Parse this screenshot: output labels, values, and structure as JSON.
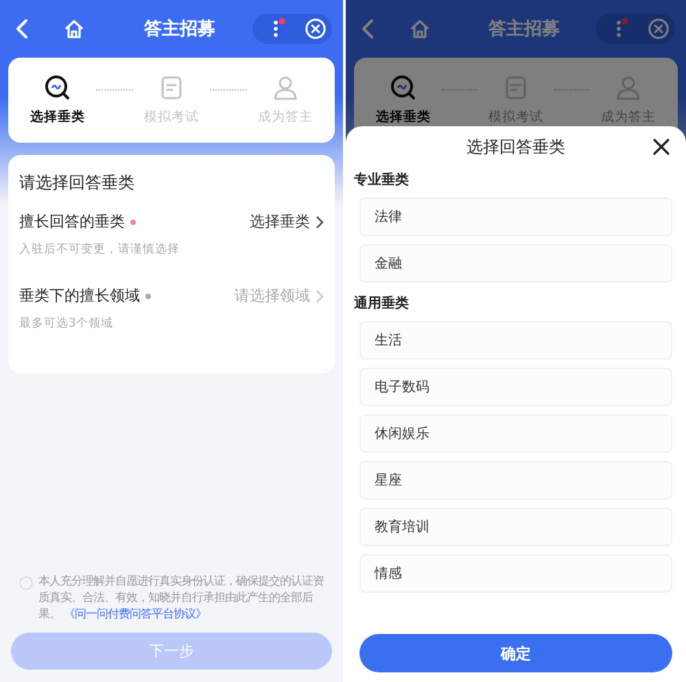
{
  "screens": [
    {
      "kind": "form",
      "header": {
        "title": "答主招募",
        "notification": true
      },
      "steps": [
        {
          "label": "选择垂类",
          "selected": true
        },
        {
          "label": "模拟考试",
          "selected": false
        },
        {
          "label": "成为答主",
          "selected": false
        }
      ],
      "form": {
        "title": "请选择回答垂类",
        "fields": [
          {
            "label": "擅长回答的垂类",
            "required": true,
            "value": "选择垂类",
            "disabled": false,
            "hint": "入驻后不可变更，请谨慎选择"
          },
          {
            "label": "垂类下的擅长领域",
            "required": true,
            "value": "请选择领域",
            "disabled": true,
            "hint": "最多可选3个领域"
          }
        ]
      },
      "agreement": {
        "checked": false,
        "text": "本人充分理解并自愿进行真实身份认证，确保提交的认证资质真实、合法、有效，知晓并自行承担由此产生的全部后果。",
        "link": "《问一问付费问答平台协议》"
      },
      "next_button": {
        "label": "下一步",
        "disabled": true
      }
    },
    {
      "kind": "sheet",
      "header": {
        "title": "答主招募",
        "notification": true
      },
      "steps": [
        {
          "label": "选择垂类",
          "selected": true
        },
        {
          "label": "模拟考试",
          "selected": false
        },
        {
          "label": "成为答主",
          "selected": false
        }
      ],
      "sheet": {
        "title": "选择回答垂类",
        "groups": [
          {
            "title": "专业垂类",
            "options": [
              "法律",
              "金融"
            ]
          },
          {
            "title": "通用垂类",
            "options": [
              "生活",
              "电子数码",
              "休闲娱乐",
              "星座",
              "教育培训",
              "情感"
            ]
          }
        ],
        "confirm": "确定"
      }
    }
  ]
}
